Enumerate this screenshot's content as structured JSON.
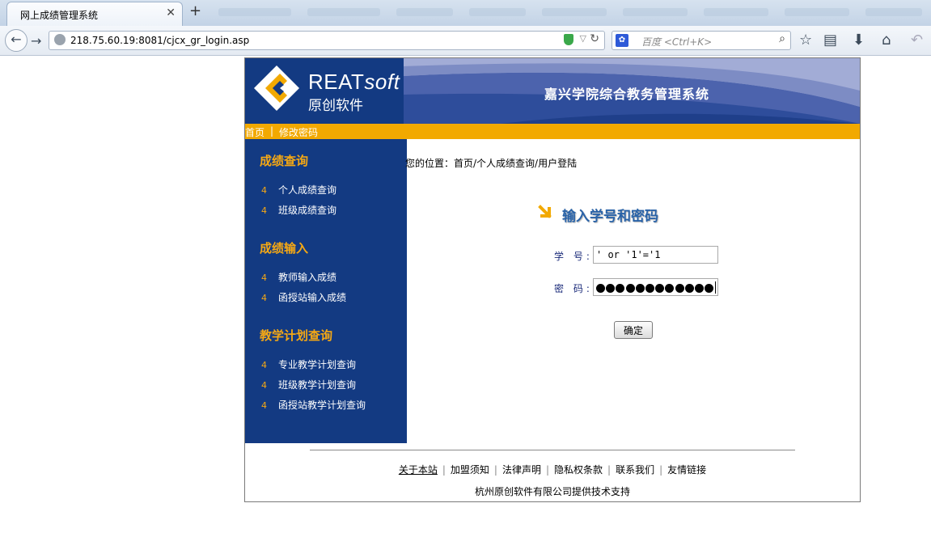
{
  "browser": {
    "tab_title": "网上成绩管理系统",
    "url": "218.75.60.19:8081/cjcx_gr_login.asp",
    "search_placeholder": "百度 <Ctrl+K>"
  },
  "site": {
    "logo_brand_main": "REAT",
    "logo_brand_soft": "soft",
    "logo_cn": "原创软件",
    "system_title": "嘉兴学院综合教务管理系统"
  },
  "menu": {
    "home": "首页",
    "separator": "|",
    "change_password": "修改密码"
  },
  "sidebar": {
    "bullet": "4",
    "sections": [
      {
        "title": "成绩查询",
        "items": [
          "个人成绩查询",
          "班级成绩查询"
        ]
      },
      {
        "title": "成绩输入",
        "items": [
          "教师输入成绩",
          "函授站输入成绩"
        ]
      },
      {
        "title": "教学计划查询",
        "items": [
          "专业教学计划查询",
          "班级教学计划查询",
          "函授站教学计划查询"
        ]
      }
    ]
  },
  "content": {
    "breadcrumb": "您的位置：首页/个人成绩查询/用户登陆",
    "login_title": "输入学号和密码",
    "studentid_label": "学 号:",
    "studentid_value": "' or '1'='1",
    "password_label": "密 码:",
    "password_length": 12,
    "confirm_button": "确定"
  },
  "footer": {
    "links": [
      "关于本站",
      "加盟须知",
      "法律声明",
      "隐私权条款",
      "联系我们",
      "友情链接"
    ],
    "support": "杭州原创软件有限公司提供技术支持"
  },
  "colors": {
    "navy": "#133a82",
    "orange": "#f2a900",
    "accent_blue": "#2a63a8"
  }
}
